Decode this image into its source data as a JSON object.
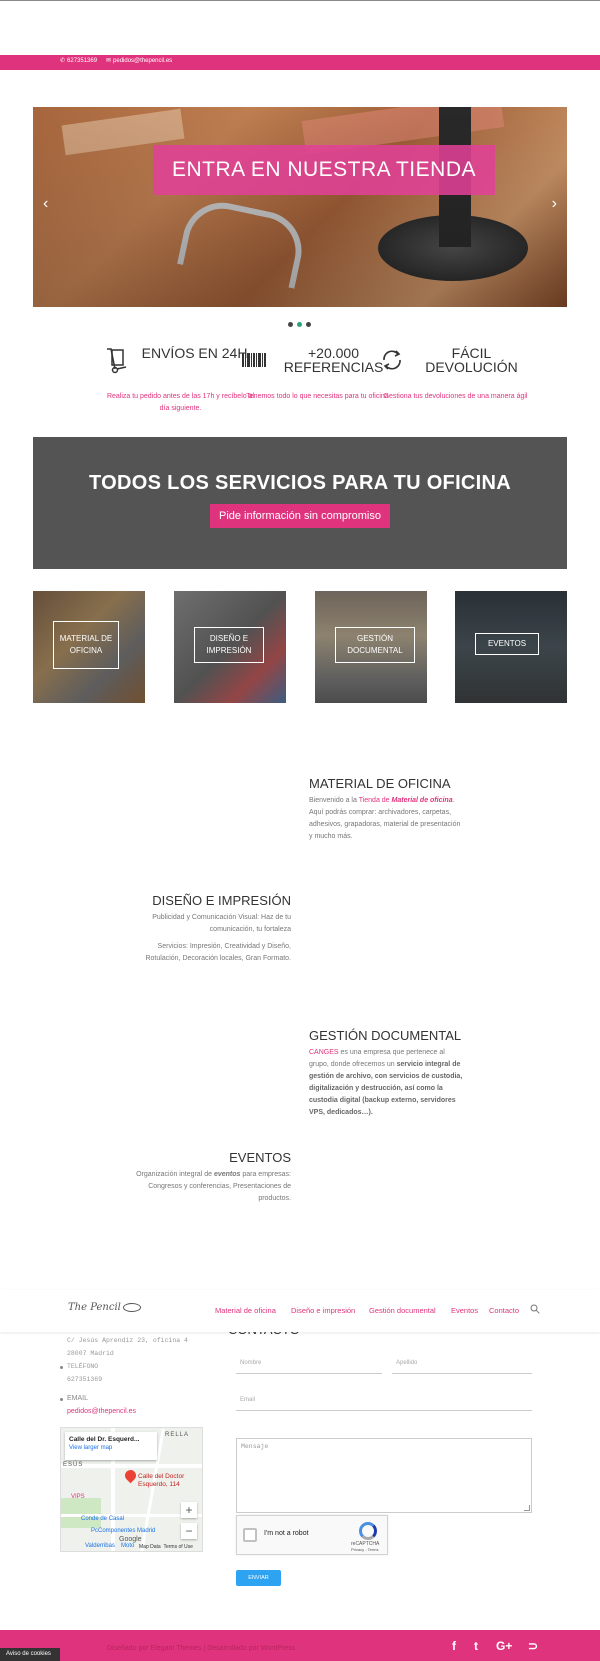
{
  "infobar": {
    "phone": "627351369",
    "email": "pedidos@thepencil.es",
    "phone_icon": "phone-icon",
    "mail_icon": "mail-icon"
  },
  "slider": {
    "cta": "ENTRA EN NUESTRA TIENDA",
    "prev": "‹",
    "next": "›",
    "slides": 3,
    "active": 2
  },
  "features": [
    {
      "title": "ENVÍOS EN 24h.",
      "desc": "Realiza tu pedido antes de las 17h y recíbelo al día siguiente.",
      "icon": "hand-truck-icon"
    },
    {
      "title": "+20.000 REFERENCIAS",
      "desc": "Tenemos todo lo que necesitas para tu oficina",
      "icon": "barcode-icon"
    },
    {
      "title": "FÁCIL DEVOLUCIÓN",
      "desc": "Gestiona tus devoluciones de una manera ágil",
      "icon": "refresh-icon"
    }
  ],
  "banner": {
    "title": "TODOS LOS SERVICIOS PARA TU OFICINA",
    "button": "Pide información sin compromiso"
  },
  "tiles": [
    {
      "label": "MATERIAL DE OFICINA"
    },
    {
      "label": "DISEÑO E IMPRESIÓN"
    },
    {
      "label": "GESTIÓN DOCUMENTAL"
    },
    {
      "label": "EVENTOS"
    }
  ],
  "sections": {
    "material": {
      "title": "MATERIAL DE OFICINA",
      "p1_a": "Bienvenido a la ",
      "p1_link": "Tienda de ",
      "p1_em": "Material de oficina",
      "p1_b": ". Aquí podrás comprar: archivadores, carpetas, adhesivos, grapadoras, material de presentación y mucho más."
    },
    "diseno": {
      "title": "DISEÑO E IMPRESIÓN",
      "p1": "Publicidad y Comunicación Visual: Haz de tu comunicación, tu fortaleza",
      "p2": "Servicios: Impresión, Creatividad y Diseño, Rotulación, Decoración locales, Gran Formato."
    },
    "gestion": {
      "title": "GESTIÓN DOCUMENTAL",
      "link": "CANGES",
      "p_a": " es una empresa que pertenece al grupo, donde ofrecemos un ",
      "p_bold": "servicio integral de gestión de archivo, con servicios de custodia, digitalización y destrucción, así como la custodia digital (backup externo, servidores VPS, dedicados…)."
    },
    "eventos": {
      "title": "EVENTOS",
      "p_a": "Organización integral de ",
      "p_em": "eventos",
      "p_b": " para empresas: Congresos y conferencias, Presentaciones de productos."
    }
  },
  "header": {
    "logo": "The Pencil",
    "nav": [
      "Material de oficina",
      "Diseño e impresión",
      "Gestión documental",
      "Eventos",
      "Contacto"
    ],
    "search_icon": "search-icon"
  },
  "contact": {
    "title": "CONTACTO",
    "address": [
      "C/ Jesús Aprendiz 23, oficina 4",
      "28007 Madrid"
    ],
    "phone_label": "TELÉFONO",
    "phone": "627351369",
    "email_label": "EMAIL",
    "email": "pedidos@thepencil.es",
    "map": {
      "place": "Calle del Dr. Esquerd...",
      "larger": "View larger map",
      "pin_label": "Calle del Doctor Esquerdo, 114",
      "labels": [
        "RELLA",
        "ESÚS",
        "VIPS",
        "Conde de Casal",
        "PcComponentes Madrid",
        "Valderribas",
        "Moto"
      ],
      "google": "Google",
      "map_data": "Map Data",
      "terms": "Terms of Use",
      "zoom_in": "+",
      "zoom_out": "−"
    },
    "form": {
      "name_placeholder": "Nombre",
      "lastname_placeholder": "Apellido",
      "email_placeholder": "Email",
      "message_placeholder": "Mensaje",
      "captcha_label": "I'm not a robot",
      "captcha_brand": "reCAPTCHA",
      "captcha_terms": "Privacy - Terms",
      "send": "ENVIAR"
    }
  },
  "footer": {
    "credit": "Diseñado por Elegant Themes | Desarrollado por WordPress",
    "social": [
      "facebook-icon",
      "twitter-icon",
      "google-plus-icon",
      "rss-icon"
    ],
    "facebook": "f",
    "twitter": "t",
    "gplus": "G+",
    "rss": "⊃"
  },
  "cookie": "Aviso de cookies",
  "colors": {
    "accent": "#e0337d",
    "banner": "#545454",
    "send": "#2ea3f2"
  }
}
